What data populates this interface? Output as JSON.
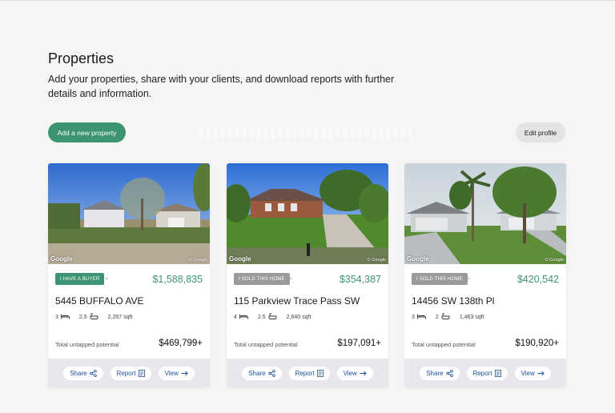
{
  "page": {
    "title": "Properties",
    "subtitle": "Add your properties, share with your clients, and download reports with further details and information."
  },
  "actions": {
    "add_property": "Add a new property",
    "edit_profile": "Edit profile"
  },
  "cards": [
    {
      "badge": "I HAVE A BUYER",
      "badge_color": "#3d9472",
      "price": "$1,588,835",
      "address": "5445 BUFFALO AVE",
      "beds": "3",
      "baths": "2.5",
      "sqft": "2,267 sqft",
      "potential_label": "Total untapped potential",
      "potential_value": "$469,799+",
      "share": "Share",
      "report": "Report",
      "view": "View",
      "google": "Google",
      "copyright": "© Google"
    },
    {
      "badge": "I SOLD THIS HOME",
      "badge_color": "#9a9a9a",
      "price": "$354,387",
      "address": "115 Parkview Trace Pass SW",
      "beds": "4",
      "baths": "2.5",
      "sqft": "2,640 sqft",
      "potential_label": "Total untapped potential",
      "potential_value": "$197,091+",
      "share": "Share",
      "report": "Report",
      "view": "View",
      "google": "Google",
      "copyright": "© Google"
    },
    {
      "badge": "I SOLD THIS HOME",
      "badge_color": "#9a9a9a",
      "price": "$420,542",
      "address": "14456 SW 138th Pl",
      "beds": "3",
      "baths": "2",
      "sqft": "1,463 sqft",
      "potential_label": "Total untapped potential",
      "potential_value": "$190,920+",
      "share": "Share",
      "report": "Report",
      "view": "View",
      "google": "Google",
      "copyright": "© Google"
    }
  ],
  "icons": {
    "bed": "bed-icon",
    "bath": "bathtub-icon",
    "share": "share-icon",
    "report": "document-icon",
    "view": "arrow-right-icon",
    "caret": "chevron-down-icon"
  },
  "colors": {
    "accent": "#3d9472",
    "link": "#1d4e9c",
    "background": "#f5f5f3"
  }
}
